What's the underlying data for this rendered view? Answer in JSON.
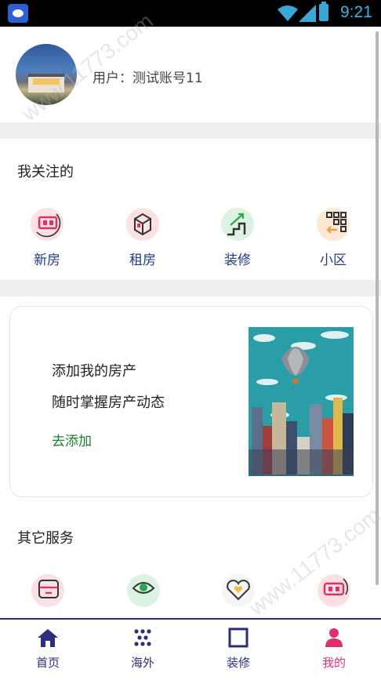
{
  "status_bar": {
    "time": "9:21"
  },
  "profile": {
    "username": "用户：测试账号11"
  },
  "follows": {
    "title": "我关注的",
    "items": [
      {
        "label": "新房",
        "icon": "new-house-icon"
      },
      {
        "label": "租房",
        "icon": "rent-box-icon"
      },
      {
        "label": "装修",
        "icon": "renovation-stairs-icon"
      },
      {
        "label": "小区",
        "icon": "community-grid-icon"
      }
    ]
  },
  "add_card": {
    "line1": "添加我的房产",
    "line2": "随时掌握房产动态",
    "link": "去添加"
  },
  "services": {
    "title": "其它服务",
    "items": [
      "calculator-icon",
      "eye-icon",
      "heart-icon",
      "vr-goggles-icon"
    ]
  },
  "tabbar": {
    "items": [
      {
        "label": "首页",
        "icon": "home-icon"
      },
      {
        "label": "海外",
        "icon": "dots-grid-icon"
      },
      {
        "label": "装修",
        "icon": "square-icon"
      },
      {
        "label": "我的",
        "icon": "person-icon"
      }
    ],
    "active_index": 3
  },
  "colors": {
    "accent": "#e0306b",
    "tab_text": "#2e2e80",
    "link": "#1a7f2a",
    "label": "#1f3a8a"
  }
}
